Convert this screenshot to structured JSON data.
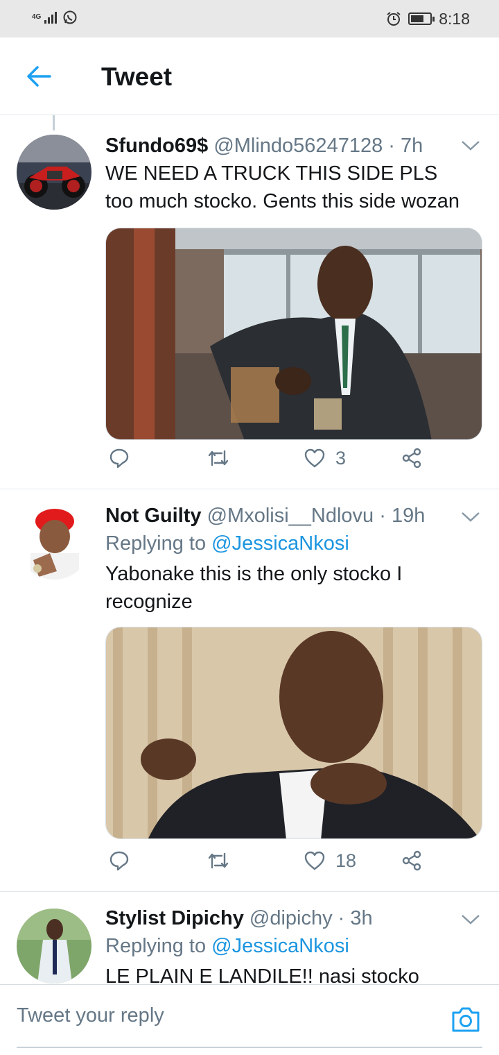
{
  "status_bar": {
    "network": "4G",
    "time": "8:18"
  },
  "header": {
    "title": "Tweet"
  },
  "tweets": [
    {
      "display_name": "Sfundo69$",
      "handle": "@Mlindo56247128",
      "time": "· 7h",
      "text": "WE NEED A TRUCK THIS SIDE PLS too much  stocko. Gents this side wozan",
      "likes": "3"
    },
    {
      "display_name": "Not Guilty",
      "handle": "@Mxolisi__Ndlovu",
      "time": "· 19h",
      "replying_prefix": "Replying to",
      "replying_to": "@JessicaNkosi",
      "text": "Yabonake this is the only stocko I recognize",
      "likes": "18"
    },
    {
      "display_name": "Stylist Dipichy",
      "handle": "@dipichy",
      "time": "· 3h",
      "replying_prefix": "Replying to",
      "replying_to": "@JessicaNkosi",
      "text": "LE PLAIN E LANDILE!! nasi stocko"
    }
  ],
  "composer": {
    "placeholder": "Tweet your reply"
  },
  "colors": {
    "accent": "#1b95e0",
    "muted": "#657786",
    "text": "#14171a",
    "divider": "#e1e8ed"
  }
}
